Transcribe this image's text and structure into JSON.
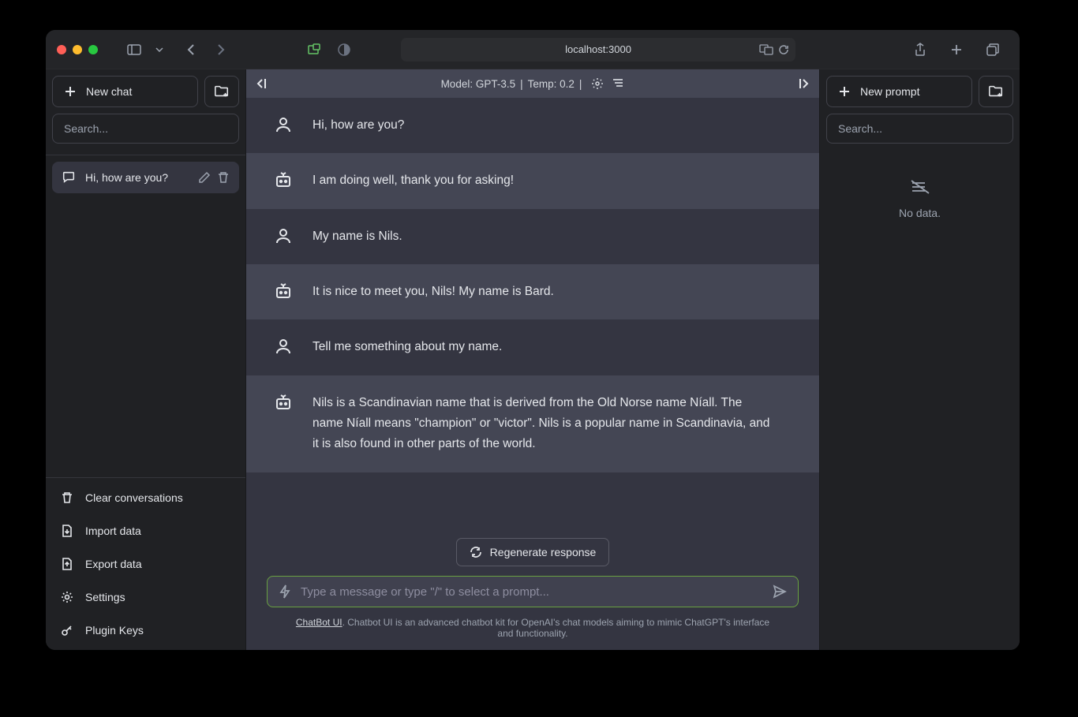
{
  "browser": {
    "url": "localhost:3000"
  },
  "left_sidebar": {
    "new_chat_label": "New chat",
    "search_placeholder": "Search...",
    "conversations": [
      {
        "title": "Hi, how are you?"
      }
    ],
    "bottom_items": {
      "clear": "Clear conversations",
      "import": "Import data",
      "export": "Export data",
      "settings": "Settings",
      "plugin_keys": "Plugin Keys"
    }
  },
  "chat": {
    "header_model": "Model: GPT-3.5",
    "header_temp": "Temp: 0.2",
    "messages": [
      {
        "role": "user",
        "text": "Hi, how are you?"
      },
      {
        "role": "assistant",
        "text": "I am doing well, thank you for asking!"
      },
      {
        "role": "user",
        "text": "My name is Nils."
      },
      {
        "role": "assistant",
        "text": "It is nice to meet you, Nils! My name is Bard."
      },
      {
        "role": "user",
        "text": "Tell me something about my name."
      },
      {
        "role": "assistant",
        "text": "Nils is a Scandinavian name that is derived from the Old Norse name Níall. The name Níall means \"champion\" or \"victor\". Nils is a popular name in Scandinavia, and it is also found in other parts of the world."
      }
    ],
    "regenerate_label": "Regenerate response",
    "input_placeholder": "Type a message or type \"/\" to select a prompt...",
    "footer_link": "ChatBot UI",
    "footer_text": ". Chatbot UI is an advanced chatbot kit for OpenAI's chat models aiming to mimic ChatGPT's interface and functionality."
  },
  "right_sidebar": {
    "new_prompt_label": "New prompt",
    "search_placeholder": "Search...",
    "no_data": "No data."
  }
}
